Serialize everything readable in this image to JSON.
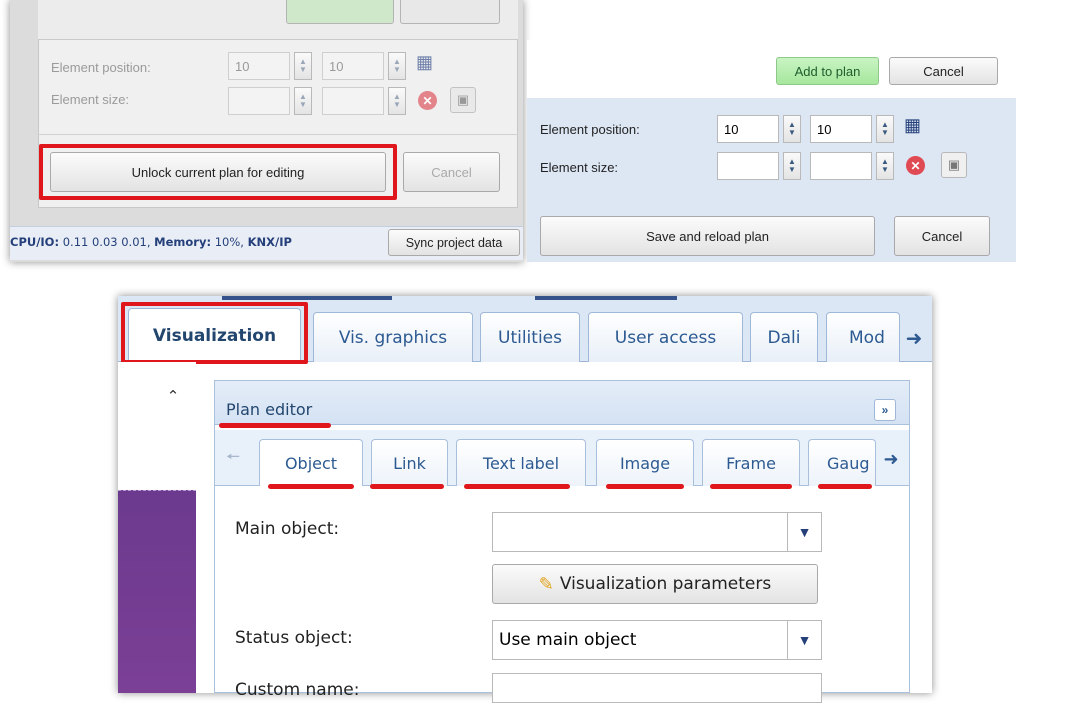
{
  "left_panel": {
    "element_position_label": "Element position:",
    "element_position_x": "10",
    "element_position_y": "10",
    "element_size_label": "Element size:",
    "unlock_label": "Unlock current plan for editing",
    "cancel_label": "Cancel"
  },
  "status_bar": {
    "cpu_label": "CPU/IO:",
    "cpu_values": " 0.11 0.03 0.01, ",
    "memory_label": "Memory:",
    "memory_value": " 10%, ",
    "knx_label": "KNX/IP",
    "sync_label": "Sync project data"
  },
  "right_panel": {
    "add_to_plan_label": "Add to plan",
    "cancel_label": "Cancel",
    "element_position_label": "Element position:",
    "element_position_x": "10",
    "element_position_y": "10",
    "element_size_label": "Element size:",
    "save_reload_label": "Save and reload plan",
    "cancel2_label": "Cancel"
  },
  "main_tabs": [
    {
      "label": "Visualization"
    },
    {
      "label": "Vis. graphics"
    },
    {
      "label": "Utilities"
    },
    {
      "label": "User access"
    },
    {
      "label": "Dali"
    },
    {
      "label": "Mod"
    }
  ],
  "plan_editor": {
    "title": "Plan editor",
    "collapse_icon": "double-chevron-right-icon",
    "subtabs": [
      {
        "label": "Object"
      },
      {
        "label": "Link"
      },
      {
        "label": "Text label"
      },
      {
        "label": "Image"
      },
      {
        "label": "Frame"
      },
      {
        "label": "Gaug"
      }
    ],
    "main_object_label": "Main object:",
    "main_object_value": "",
    "vis_params_label": "Visualization parameters",
    "status_object_label": "Status object:",
    "status_object_value": "Use main object",
    "custom_name_label": "Custom name:"
  },
  "colors": {
    "highlight_red": "#e0161d",
    "panel_blue": "#dde7f4",
    "tab_text_blue": "#2c5a91",
    "add_button_green": "#b9eeb3"
  }
}
